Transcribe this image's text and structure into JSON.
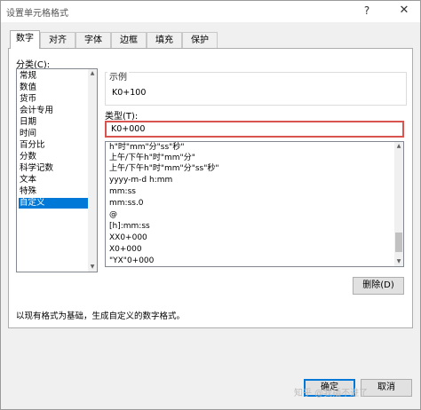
{
  "dialog": {
    "title": "设置单元格格式",
    "help_symbol": "?",
    "close_symbol": "✕"
  },
  "tabs": [
    {
      "label": "数字",
      "active": true
    },
    {
      "label": "对齐"
    },
    {
      "label": "字体"
    },
    {
      "label": "边框"
    },
    {
      "label": "填充"
    },
    {
      "label": "保护"
    }
  ],
  "category": {
    "label": "分类(C):",
    "items": [
      "常规",
      "数值",
      "货币",
      "会计专用",
      "日期",
      "时间",
      "百分比",
      "分数",
      "科学记数",
      "文本",
      "特殊",
      "自定义"
    ],
    "selected": "自定义"
  },
  "sample": {
    "label": "示例",
    "value": "K0+100"
  },
  "type": {
    "label": "类型(T):",
    "value": "K0+000",
    "options": [
      "h\"时\"mm\"分\"ss\"秒\"",
      "上午/下午h\"时\"mm\"分\"",
      "上午/下午h\"时\"mm\"分\"ss\"秒\"",
      "yyyy-m-d h:mm",
      "mm:ss",
      "mm:ss.0",
      "@",
      "[h]:mm:ss",
      "XX0+000",
      "X0+000",
      "\"YX\"0+000"
    ]
  },
  "buttons": {
    "delete": "删除(D)",
    "ok": "确定",
    "cancel": "取消"
  },
  "description": "以现有格式为基础，生成自定义的数字格式。",
  "watermark": "知乎 @我插不进了",
  "colors": {
    "accent": "#0078d7",
    "highlight_border": "#d9534f",
    "dialog_bg": "#f0f0f0"
  }
}
